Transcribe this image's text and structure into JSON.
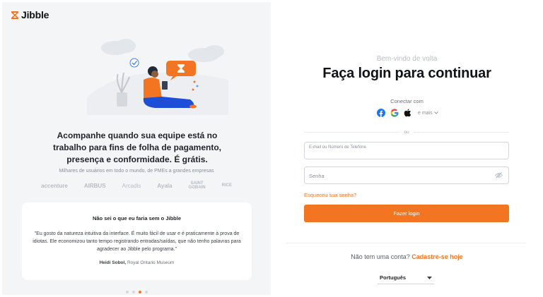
{
  "brand": {
    "name": "Jibble",
    "accent": "#f47521"
  },
  "left": {
    "headline": "Acompanhe quando sua equipe está no trabalho para fins de folha de pagamento, presença e conformidade. É grátis.",
    "subline": "Milhares de usuários em todo o mundo, de PMEs a grandes empresas",
    "client_logos": [
      "accenture",
      "AIRBUS",
      "Arcadis",
      "Ayala",
      "SAINT GOBAIN",
      "RICE"
    ],
    "testimonial": {
      "title": "Não sei o que eu faria sem o Jibble",
      "quote": "\"Eu gosto da natureza intuitiva da interface. É muito fácil de usar e é praticamente à prova de idiotas. Ele economizou tanto tempo registrando entradas/saídas, que não tenho palavras para agradecer ao Jibble pelo programa.\"",
      "author": "Heidi Sobol,",
      "org": "Royal Ontario Museum"
    },
    "carousel": {
      "count": 4,
      "active_index": 2
    }
  },
  "right": {
    "welcome": "Bem-vindo de volta",
    "title": "Faça login para continuar",
    "connect_label": "Conectar com",
    "social": [
      "facebook-icon",
      "google-icon",
      "apple-icon"
    ],
    "more_label": "e mais",
    "or_label": "ou",
    "email_label": "E-mail ou Número de Telefone",
    "password_placeholder": "Senha",
    "forgot_label": "Esqueceu sua senha?",
    "login_button": "Fazer login",
    "signup_prompt": "Não tem uma conta?",
    "signup_link": "Cadastre-se hoje",
    "language": "Português"
  }
}
